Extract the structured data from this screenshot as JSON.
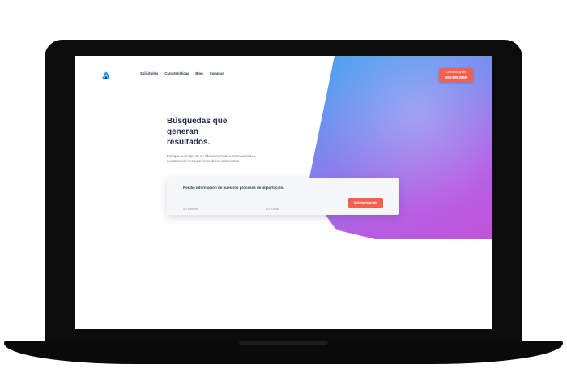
{
  "nav": {
    "items": [
      {
        "label": "Solicitudes"
      },
      {
        "label": "Características"
      },
      {
        "label": "Blog"
      },
      {
        "label": "Comprar"
      }
    ]
  },
  "cta": {
    "label": "Llamanos gratis",
    "phone": "098-995-2939"
  },
  "hero": {
    "headline_lines": [
      "Búsquedas que",
      "generan",
      "resultados."
    ],
    "subtext_lines": [
      "Enfoque su empresa en liderar mercados internacionales,",
      "nosotros nos encargarémos de los suministros."
    ]
  },
  "form": {
    "title": "Recibe información de nuestros procesos de importación.",
    "name_placeholder": "Su nombre",
    "email_placeholder": "Su e-mail",
    "submit_label": "Solicitarlo gratis"
  },
  "colors": {
    "accent": "#f2604f",
    "heading": "#1f2c4a",
    "gradient_start": "#3fa8f0",
    "gradient_end": "#c64fd3"
  }
}
